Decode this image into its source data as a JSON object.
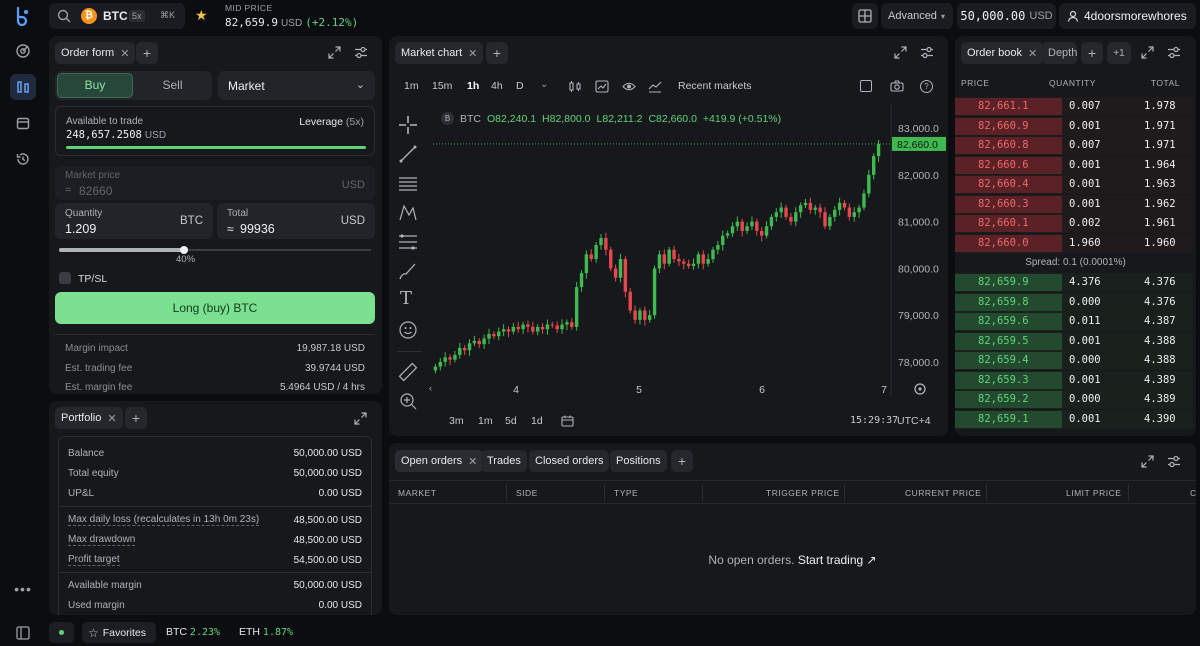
{
  "topbar": {
    "asset": "BTC",
    "asset_leverage": "5x",
    "shortcut": "⌘K",
    "mid_price_label": "MID PRICE",
    "mid_price_value": "82,659.9",
    "mid_price_unit": "USD",
    "mid_price_change": "(+2.12%)",
    "mode": "Advanced",
    "balance": "50,000.00",
    "balance_unit": "USD",
    "username": "4doorsmorewhores"
  },
  "order_form": {
    "tab_label": "Order form",
    "buy_label": "Buy",
    "sell_label": "Sell",
    "order_type": "Market",
    "available_label": "Available to trade",
    "available_value": "248,657.2508",
    "available_unit": "USD",
    "leverage_label": "Leverage",
    "leverage_value": "(5x)",
    "market_price_label": "Market price",
    "market_price_value": "82660",
    "market_price_unit": "USD",
    "approx": "≈",
    "quantity_label": "Quantity",
    "quantity_value": "1.209",
    "quantity_unit": "BTC",
    "total_label": "Total",
    "total_value": "99936",
    "total_unit": "USD",
    "slider_pct": "40%",
    "slider_fraction": 0.4,
    "tpsl_label": "TP/SL",
    "submit_label": "Long (buy) BTC",
    "margin_impact_label": "Margin impact",
    "margin_impact_value": "19,987.18 USD",
    "trading_fee_label": "Est. trading fee",
    "trading_fee_value": "39.9744 USD",
    "margin_fee_label": "Est. margin fee",
    "margin_fee_value": "5.4964 USD / 4 hrs"
  },
  "portfolio": {
    "tab_label": "Portfolio",
    "rows": [
      {
        "label": "Balance",
        "value": "50,000.00 USD"
      },
      {
        "label": "Total equity",
        "value": "50,000.00 USD"
      },
      {
        "label": "UP&L",
        "value": "0.00 USD"
      },
      {
        "label": "Max daily loss (recalculates in 13h 0m 23s)",
        "value": "48,500.00 USD"
      },
      {
        "label": "Max drawdown",
        "value": "48,500.00 USD"
      },
      {
        "label": "Profit target",
        "value": "54,500.00 USD"
      },
      {
        "label": "Available margin",
        "value": "50,000.00 USD"
      },
      {
        "label": "Used margin",
        "value": "0.00 USD"
      }
    ]
  },
  "chart": {
    "tab_label": "Market chart",
    "timeframes": [
      "1m",
      "15m",
      "1h",
      "4h",
      "D"
    ],
    "active_timeframe": "1h",
    "recent_markets": "Recent markets",
    "symbol": "BTC",
    "ohlc": {
      "o": "O82,240.1",
      "h": "H82,800.0",
      "l": "L82,211.2",
      "c": "C82,660.0",
      "change": "+419.9 (+0.51%)"
    },
    "last_price_label": "82,660.0",
    "y_ticks": [
      "83,000.0",
      "82,000.0",
      "81,000.0",
      "80,000.0",
      "79,000.0",
      "78,000.0"
    ],
    "x_ticks": [
      "4",
      "5",
      "6",
      "7"
    ],
    "ranges": [
      "3m",
      "1m",
      "5d",
      "1d"
    ],
    "time": "15:29:37",
    "timezone": "UTC+4",
    "up_color": "#3fb950",
    "down_color": "#e5484d"
  },
  "chart_data": {
    "type": "candlestick",
    "symbol": "BTC",
    "ylim": [
      77700,
      83300
    ],
    "y_ticks": [
      83000,
      82000,
      81000,
      80000,
      79000,
      78000
    ],
    "x_ticks": [
      "4",
      "5",
      "6",
      "7"
    ],
    "last_price": 82660,
    "closes": [
      77900,
      78000,
      78100,
      78050,
      78150,
      78300,
      78250,
      78400,
      78450,
      78380,
      78500,
      78600,
      78550,
      78650,
      78700,
      78650,
      78750,
      78700,
      78800,
      78750,
      78650,
      78750,
      78700,
      78800,
      78780,
      78700,
      78800,
      78850,
      78750,
      79600,
      79900,
      80300,
      80200,
      80500,
      80650,
      80400,
      80000,
      79800,
      80200,
      79500,
      79100,
      78900,
      79100,
      78900,
      79000,
      80000,
      80300,
      80100,
      80400,
      80200,
      80150,
      80100,
      80050,
      80100,
      80300,
      80100,
      80200,
      80400,
      80500,
      80700,
      80750,
      80900,
      81000,
      80800,
      80900,
      81000,
      80800,
      80700,
      80900,
      81100,
      81200,
      81300,
      81100,
      81000,
      81200,
      81350,
      81400,
      81250,
      81300,
      81200,
      80900,
      81100,
      81250,
      81400,
      81300,
      81100,
      81200,
      81300,
      81600,
      82000,
      82400,
      82660
    ]
  },
  "orderbook": {
    "tabs": [
      "Order book",
      "Depth"
    ],
    "more": "+1",
    "headers": [
      "PRICE",
      "QUANTITY",
      "TOTAL"
    ],
    "asks": [
      {
        "price": "82,661.1",
        "qty": "0.007",
        "total": "1.978"
      },
      {
        "price": "82,660.9",
        "qty": "0.001",
        "total": "1.971"
      },
      {
        "price": "82,660.8",
        "qty": "0.007",
        "total": "1.971"
      },
      {
        "price": "82,660.6",
        "qty": "0.001",
        "total": "1.964"
      },
      {
        "price": "82,660.4",
        "qty": "0.001",
        "total": "1.963"
      },
      {
        "price": "82,660.3",
        "qty": "0.001",
        "total": "1.962"
      },
      {
        "price": "82,660.1",
        "qty": "0.002",
        "total": "1.961"
      },
      {
        "price": "82,660.0",
        "qty": "1.960",
        "total": "1.960"
      }
    ],
    "spread": "Spread: 0.1 (0.0001%)",
    "bids": [
      {
        "price": "82,659.9",
        "qty": "4.376",
        "total": "4.376"
      },
      {
        "price": "82,659.8",
        "qty": "0.000",
        "total": "4.376"
      },
      {
        "price": "82,659.6",
        "qty": "0.011",
        "total": "4.387"
      },
      {
        "price": "82,659.5",
        "qty": "0.001",
        "total": "4.388"
      },
      {
        "price": "82,659.4",
        "qty": "0.000",
        "total": "4.388"
      },
      {
        "price": "82,659.3",
        "qty": "0.001",
        "total": "4.389"
      },
      {
        "price": "82,659.2",
        "qty": "0.000",
        "total": "4.389"
      },
      {
        "price": "82,659.1",
        "qty": "0.001",
        "total": "4.390"
      }
    ]
  },
  "orders": {
    "tabs": [
      "Open orders",
      "Trades",
      "Closed orders",
      "Positions"
    ],
    "columns": [
      "MARKET",
      "SIDE",
      "TYPE",
      "TRIGGER PRICE",
      "CURRENT PRICE",
      "LIMIT PRICE",
      "C"
    ],
    "empty_text": "No open orders.",
    "empty_link": "Start trading"
  },
  "bottombar": {
    "favorites": "Favorites",
    "tickers": [
      {
        "symbol": "BTC",
        "change": "2.23%"
      },
      {
        "symbol": "ETH",
        "change": "1.87%"
      }
    ]
  }
}
